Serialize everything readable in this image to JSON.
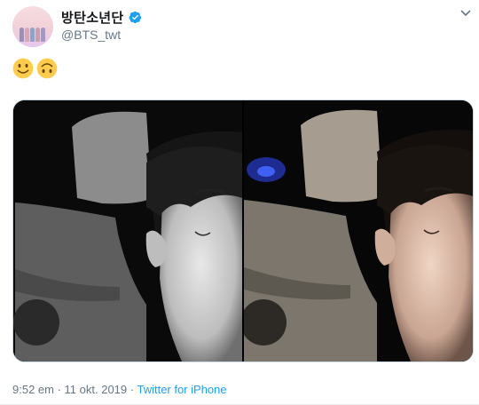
{
  "author": {
    "display_name": "방탄소년단",
    "handle": "@BTS_twt",
    "verified": true,
    "avatar_icon": "group-photo-avatar"
  },
  "menu_icon": "chevron-down-icon",
  "tweet": {
    "emojis": [
      "slightly-smiling-face-emoji",
      "upside-down-face-emoji"
    ],
    "media": [
      {
        "name": "photo-1",
        "style": "black-and-white selfie in car"
      },
      {
        "name": "photo-2",
        "style": "color selfie in car"
      }
    ]
  },
  "footer": {
    "time": "9:52 em",
    "separator": " · ",
    "date": "11 okt. 2019",
    "separator2": " · ",
    "source": "Twitter for iPhone"
  },
  "colors": {
    "link": "#1da1f2",
    "secondary_text": "#657786",
    "verified_badge": "#1da1f2",
    "emoji_yellow": "#ffcc4d"
  }
}
